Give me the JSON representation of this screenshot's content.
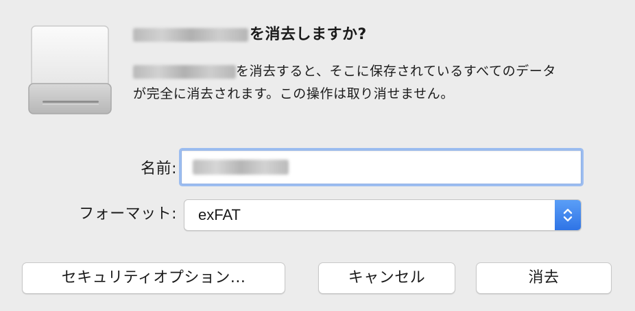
{
  "dialog": {
    "title_suffix": "を消去しますか?",
    "message_line1_suffix": "を消去すると、そこに保存されているすべてのデータ",
    "message_line2": "が完全に消去されます。この操作は取り消せません。"
  },
  "form": {
    "name_label": "名前:",
    "format_label": "フォーマット:",
    "format_value": "exFAT"
  },
  "buttons": {
    "security_options": "セキュリティオプション...",
    "cancel": "キャンセル",
    "erase": "消去"
  },
  "colors": {
    "accent": "#3b82f0",
    "focus_ring": "#9cbdf0",
    "background": "#ececec"
  },
  "icons": {
    "drive": "external-drive-icon",
    "stepper": "chevron-up-down-icon"
  }
}
